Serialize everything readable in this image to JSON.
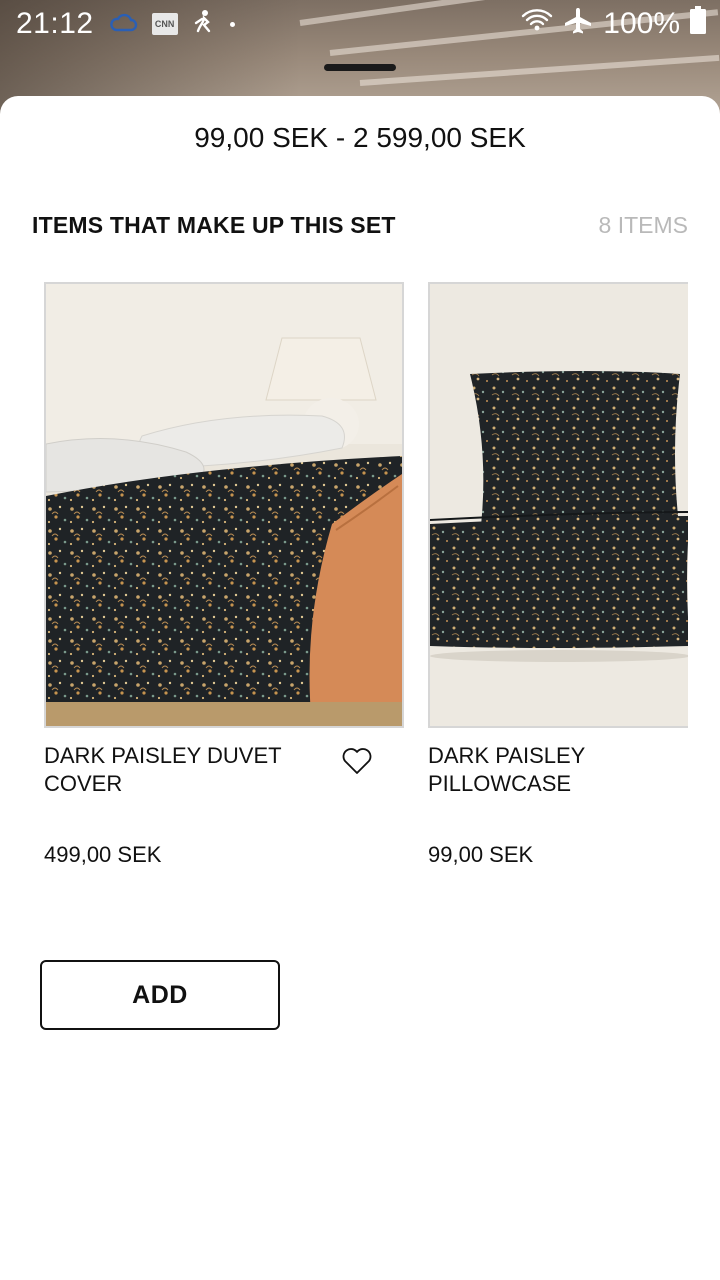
{
  "status_bar": {
    "time": "21:12",
    "battery_text": "100%",
    "cnn_label": "CNN",
    "icons": [
      "cloud-icon",
      "cnn-icon",
      "fitness-icon",
      "dot-icon",
      "wifi-icon",
      "airplane-icon",
      "battery-icon"
    ]
  },
  "sheet": {
    "price_range": "99,00 SEK - 2 599,00 SEK",
    "set_title": "ITEMS THAT MAKE UP THIS SET",
    "set_count": "8 ITEMS",
    "add_label": "ADD"
  },
  "products": [
    {
      "name": "DARK PAISLEY DUVET COVER",
      "price": "499,00 SEK",
      "image": "duvet-cover-photo"
    },
    {
      "name": "DARK PAISLEY PILLOWCASE",
      "price": "99,00 SEK",
      "image": "pillowcase-photo"
    }
  ],
  "colors": {
    "paisley_dark": "#1f2326",
    "terracotta": "#d58a57",
    "linen": "#ececea",
    "wall": "#ede9e1"
  }
}
